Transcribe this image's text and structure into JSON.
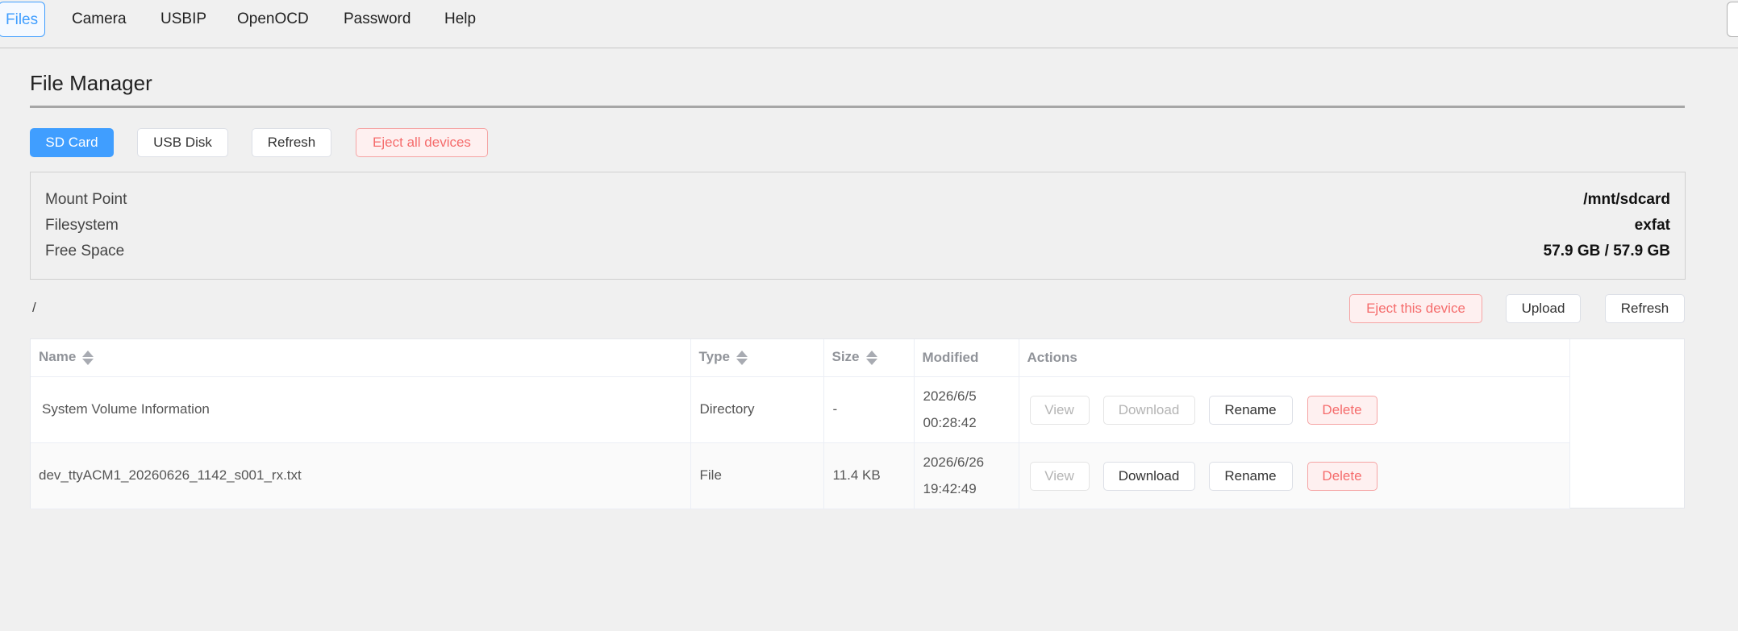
{
  "nav": {
    "items": [
      {
        "label": "Files",
        "active": true
      },
      {
        "label": "Camera"
      },
      {
        "label": "USBIP"
      },
      {
        "label": "OpenOCD"
      },
      {
        "label": "Password"
      },
      {
        "label": "Help"
      }
    ]
  },
  "page": {
    "title": "File Manager"
  },
  "device_tabs": {
    "sd_card": "SD Card",
    "usb_disk": "USB Disk",
    "refresh": "Refresh",
    "eject_all": "Eject all devices"
  },
  "info": {
    "mount_point_label": "Mount Point",
    "mount_point_value": "/mnt/sdcard",
    "filesystem_label": "Filesystem",
    "filesystem_value": "exfat",
    "free_space_label": "Free Space",
    "free_space_value": "57.9 GB / 57.9 GB"
  },
  "path": "/",
  "path_actions": {
    "eject": "Eject this device",
    "upload": "Upload",
    "refresh": "Refresh"
  },
  "table": {
    "headers": {
      "name": "Name",
      "type": "Type",
      "size": "Size",
      "modified": "Modified",
      "actions": "Actions"
    },
    "rows": [
      {
        "name": "System Volume Information",
        "type": "Directory",
        "size": "-",
        "modified_date": "2026/6/5",
        "modified_time": "00:28:42",
        "view": "View",
        "download": "Download",
        "rename": "Rename",
        "delete": "Delete"
      },
      {
        "name": "dev_ttyACM1_20260626_1142_s001_rx.txt",
        "type": "File",
        "size": "11.4 KB",
        "modified_date": "2026/6/26",
        "modified_time": "19:42:49",
        "view": "View",
        "download": "Download",
        "rename": "Rename",
        "delete": "Delete"
      }
    ]
  },
  "colors": {
    "primary": "#409eff",
    "danger": "#f56c6c",
    "background": "#f0f0f0"
  }
}
